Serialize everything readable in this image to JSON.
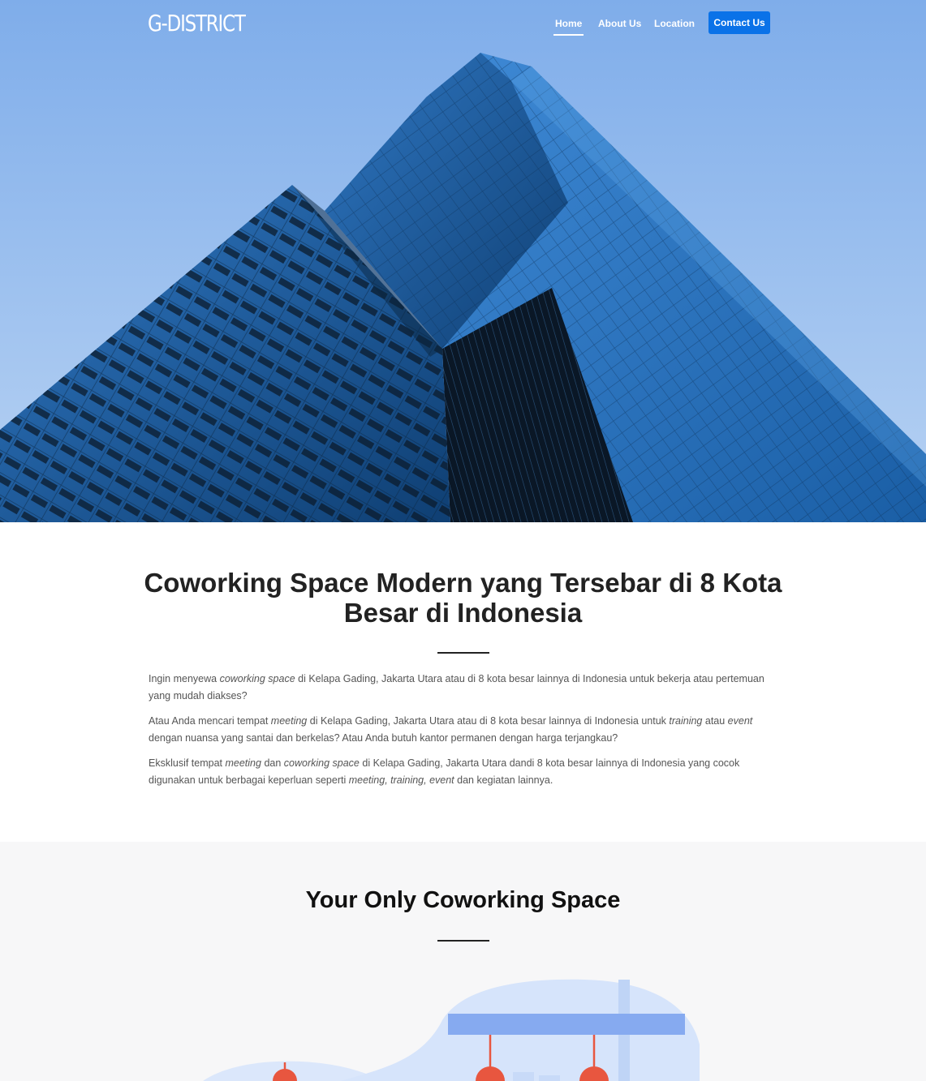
{
  "brand": {
    "logo_text": "G-DISTRICT"
  },
  "nav": {
    "items": [
      {
        "label": "Home",
        "active": true
      },
      {
        "label": "About Us"
      },
      {
        "label": "Location"
      }
    ],
    "cta_label": "Contact Us"
  },
  "intro": {
    "title": "Coworking Space Modern yang Tersebar di 8 Kota Besar di Indonesia",
    "paragraphs": [
      [
        "Ingin menyewa ",
        {
          "em": "coworking space"
        },
        " di Kelapa Gading, Jakarta Utara atau di 8 kota besar lainnya di Indonesia untuk bekerja atau pertemuan yang mudah diakses?"
      ],
      [
        "Atau Anda mencari tempat ",
        {
          "em": "meeting"
        },
        " di Kelapa Gading, Jakarta Utara atau di 8 kota besar lainnya di Indonesia untuk ",
        {
          "em": "training"
        },
        " atau ",
        {
          "em": "event"
        },
        " dengan nuansa yang santai dan berkelas? Atau Anda butuh kantor permanen dengan harga terjangkau?"
      ],
      [
        "Eksklusif tempat ",
        {
          "em": "meeting"
        },
        " dan ",
        {
          "em": "coworking space"
        },
        " di Kelapa Gading, Jakarta Utara dandi 8 kota besar lainnya di Indonesia yang cocok digunakan untuk berbagai keperluan seperti ",
        {
          "em": "meeting, training, event"
        },
        " dan kegiatan lainnya."
      ]
    ]
  },
  "section2": {
    "title": "Your Only Coworking Space"
  },
  "colors": {
    "accent": "#0a72e8",
    "sky": "#8fb8ea",
    "glass": "#1d5e9e",
    "section_bg": "#f7f7f8",
    "lamp": "#e8563f"
  }
}
